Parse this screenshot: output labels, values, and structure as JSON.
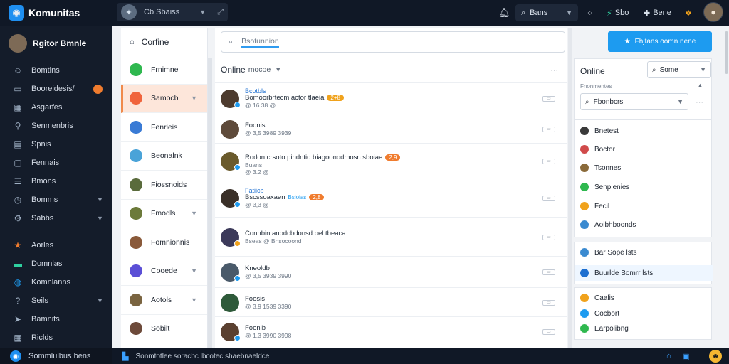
{
  "app": {
    "title": "Komunitas"
  },
  "topbar": {
    "switcher_label": "Cb Sbaiss",
    "search_label": "Bans",
    "item_a": "Sbo",
    "item_b": "Bene"
  },
  "sidebar": {
    "user_name": "Rgitor Bmnle",
    "items": [
      {
        "label": "Bomtins",
        "icon": "people-icon"
      },
      {
        "label": "Booreidesis/",
        "icon": "inbox-icon",
        "badge": "!"
      },
      {
        "label": "Asgarfes",
        "icon": "calendar-icon"
      },
      {
        "label": "Senmenbris",
        "icon": "wrench-icon"
      },
      {
        "label": "Spnis",
        "icon": "document-icon"
      },
      {
        "label": "Fennais",
        "icon": "folder-icon"
      },
      {
        "label": "Bmons",
        "icon": "list-icon"
      },
      {
        "label": "Bomms",
        "icon": "clock-icon",
        "chevron": true
      },
      {
        "label": "Sabbs",
        "icon": "settings-icon",
        "chevron": true
      },
      {
        "label": "Aorles",
        "icon": "star-icon"
      },
      {
        "label": "Domnlas",
        "icon": "chat-icon"
      },
      {
        "label": "Komnlanns",
        "icon": "globe-icon"
      },
      {
        "label": "Seils",
        "icon": "help-icon",
        "chevron": true
      },
      {
        "label": "Bamnits",
        "icon": "pin-icon"
      },
      {
        "label": "Riclds",
        "icon": "grid-icon"
      }
    ],
    "bottom_label": "Sommlulbus bens"
  },
  "communities": {
    "header": "Corfine",
    "items": [
      {
        "label": "Frnimne",
        "color": "#2fb84f",
        "active": false,
        "chevron": false
      },
      {
        "label": "Samocb",
        "color": "#f0643c",
        "active": true,
        "chevron": true
      },
      {
        "label": "Fenrieis",
        "color": "#3a7bd5",
        "active": false,
        "chevron": false
      },
      {
        "label": "Beonalnk",
        "color": "#4aa3d8",
        "active": false,
        "chevron": false
      },
      {
        "label": "Fiossnoids",
        "color": "#5a6b3c",
        "active": false,
        "chevron": false
      },
      {
        "label": "Fmodls",
        "color": "#6c7a3a",
        "active": false,
        "chevron": true
      },
      {
        "label": "Fomnionnis",
        "color": "#8a5a3a",
        "active": false,
        "chevron": false
      },
      {
        "label": "Cooede",
        "color": "#5b4fd6",
        "active": false,
        "chevron": true
      },
      {
        "label": "Aotols",
        "color": "#7a6440",
        "active": false,
        "chevron": true
      },
      {
        "label": "Sobilt",
        "color": "#6d4a3a",
        "active": false,
        "chevron": false
      }
    ]
  },
  "main": {
    "search_placeholder": "Bsotunnion",
    "list_title": "Online",
    "list_sort": "mocoe",
    "rows": [
      {
        "top": "Bcotbls",
        "name": "Bomoorbrtecm actor tlaeia",
        "tag": "2+8",
        "tag_color": "#f0a21c",
        "meta": "@ 16.38 @",
        "av": "#4d3b2e",
        "dot": "#1d9bf0"
      },
      {
        "top": "",
        "name": "Foonis",
        "tag": "",
        "tag_color": "",
        "meta": "@ 3,5 3989 3939",
        "av": "#5e4a3a",
        "dot": ""
      },
      {
        "top": "",
        "name": "Rodon crsoto pindntio biagoonodmosn sboiae",
        "tag": "2,9",
        "tag_color": "#f07c2e",
        "meta": "Buans",
        "meta2": "@ 3.2 @",
        "av": "#6a5a2c",
        "dot": "#1d9bf0"
      },
      {
        "top": "Fatiicb",
        "name": "Bscssoaxaen",
        "tag": "2,8",
        "tag_color": "#f07c2e",
        "tag2": "Bsioias",
        "meta": "@ 3,3 @",
        "av": "#3a3028",
        "dot": "#1d9bf0"
      },
      {
        "top": "",
        "name": "Connbin anodcbdonsd oel tbeaca",
        "tag": "",
        "tag_color": "",
        "meta": "Bseas @ Bhsocoond",
        "av": "#3c3a5a",
        "dot": "#f0a21c"
      },
      {
        "top": "",
        "name": "Kneoldb",
        "tag": "",
        "tag_color": "",
        "meta": "@ 3,5 3939 3990",
        "av": "#4a5a6a",
        "dot": "#1d9bf0"
      },
      {
        "top": "",
        "name": "Foosis",
        "tag": "",
        "tag_color": "",
        "meta": "@ 3.9 1539 3390",
        "av": "#2e5a3a",
        "dot": ""
      },
      {
        "top": "",
        "name": "Foenlb",
        "tag": "",
        "tag_color": "",
        "meta": "@ 1,3 3990 3998",
        "av": "#5a4030",
        "dot": "#1d9bf0"
      }
    ]
  },
  "right": {
    "cta_label": "Fhjtans oomn nene",
    "online_title": "Online",
    "online_select": "Some",
    "online_sub": "Fnonmentes",
    "search2": "Fbonbcrs",
    "list1": [
      {
        "label": "Bnetest",
        "color": "#3a3a3a"
      },
      {
        "label": "Boctor",
        "color": "#d04a4a"
      },
      {
        "label": "Tsonnes",
        "color": "#8a6a3a"
      },
      {
        "label": "Senplenies",
        "color": "#2fb84f"
      },
      {
        "label": "Fecil",
        "color": "#f0a21c"
      },
      {
        "label": "Aoibhboonds",
        "color": "#3a8ad0"
      }
    ],
    "list2": [
      {
        "label": "Bar Sope lsts",
        "color": "#3a8ad0"
      },
      {
        "label": "Buurlde Bomrr lsts",
        "color": "#1d6fd0"
      }
    ],
    "list3": [
      {
        "label": "Caalis",
        "color": "#f0a21c"
      },
      {
        "label": "Cocbort",
        "color": "#1d9bf0"
      },
      {
        "label": "Earpolibng",
        "color": "#2fb84f"
      }
    ]
  },
  "statusbar": {
    "label": "Sonmtotlee soracbc lbcotec shaebnaeldce"
  }
}
